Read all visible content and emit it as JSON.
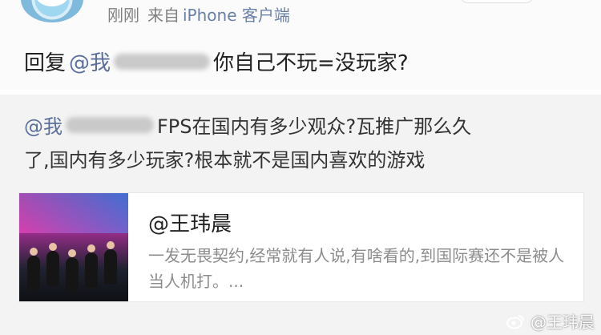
{
  "post_header": {
    "time": "刚刚",
    "from_label": "来自",
    "client": "iPhone 客户端"
  },
  "reply": {
    "prefix": "回复",
    "mention": "@我",
    "text": "你自己不玩=没玩家?"
  },
  "quoted_comment": {
    "mention": "@我",
    "line1_rest": "FPS在国内有多少观众?瓦推广那么久",
    "line2": "了,国内有多少玩家?根本就不是国内喜欢的游戏"
  },
  "link_card": {
    "title": "@王玮晨",
    "description": "一发无畏契约,经常就有人说,有啥看的,到国际赛还不是被人当人机打。..."
  },
  "watermark": {
    "icon": "weibo-icon",
    "text": "@王玮晨"
  }
}
